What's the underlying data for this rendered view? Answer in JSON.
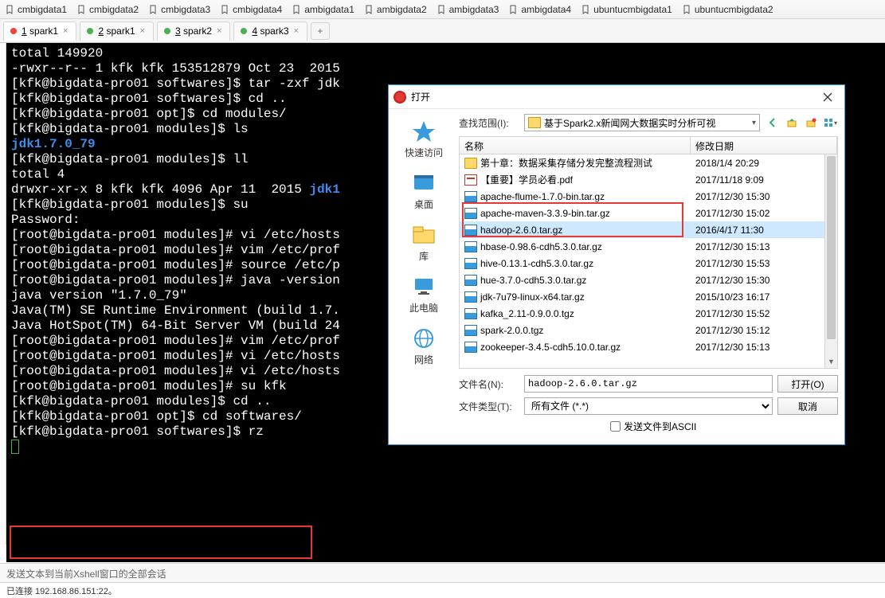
{
  "bookmarks": [
    "cmbigdata1",
    "cmbigdata2",
    "cmbigdata3",
    "cmbigdata4",
    "ambigdata1",
    "ambigdata2",
    "ambigdata3",
    "ambigdata4",
    "ubuntucmbigdata1",
    "ubuntucmbigdata2"
  ],
  "tabs": [
    {
      "num": "1",
      "label": "spark1",
      "active": true,
      "dot": "red"
    },
    {
      "num": "2",
      "label": "spark1",
      "active": false,
      "dot": "green"
    },
    {
      "num": "3",
      "label": "spark2",
      "active": false,
      "dot": "green"
    },
    {
      "num": "4",
      "label": "spark3",
      "active": false,
      "dot": "green"
    }
  ],
  "terminal_lines": [
    {
      "t": "total 149920"
    },
    {
      "t": "-rwxr--r-- 1 kfk kfk 153512879 Oct 23  2015"
    },
    {
      "t": "[kfk@bigdata-pro01 softwares]$ tar -zxf jdk"
    },
    {
      "t": "[kfk@bigdata-pro01 softwares]$ cd .."
    },
    {
      "t": "[kfk@bigdata-pro01 opt]$ cd modules/"
    },
    {
      "t": "[kfk@bigdata-pro01 modules]$ ls"
    },
    {
      "t": "jdk1.7.0_79",
      "cls": "dir"
    },
    {
      "t": "[kfk@bigdata-pro01 modules]$ ll"
    },
    {
      "t": "total 4"
    },
    {
      "t": "drwxr-xr-x 8 kfk kfk 4096 Apr 11  2015 ",
      "tail": "jdk1",
      "tailcls": "dir"
    },
    {
      "t": "[kfk@bigdata-pro01 modules]$ su"
    },
    {
      "t": "Password:"
    },
    {
      "t": "[root@bigdata-pro01 modules]# vi /etc/hosts"
    },
    {
      "t": "[root@bigdata-pro01 modules]# vim /etc/prof"
    },
    {
      "t": "[root@bigdata-pro01 modules]# source /etc/p"
    },
    {
      "t": "[root@bigdata-pro01 modules]# java -version"
    },
    {
      "t": "java version \"1.7.0_79\""
    },
    {
      "t": "Java(TM) SE Runtime Environment (build 1.7."
    },
    {
      "t": "Java HotSpot(TM) 64-Bit Server VM (build 24"
    },
    {
      "t": "[root@bigdata-pro01 modules]# vim /etc/prof"
    },
    {
      "t": "[root@bigdata-pro01 modules]# vi /etc/hosts"
    },
    {
      "t": "[root@bigdata-pro01 modules]# vi /etc/hosts"
    },
    {
      "t": "[root@bigdata-pro01 modules]# su kfk"
    },
    {
      "t": "[kfk@bigdata-pro01 modules]$ cd .."
    },
    {
      "t": "[kfk@bigdata-pro01 opt]$ cd softwares/"
    },
    {
      "t": "[kfk@bigdata-pro01 softwares]$ rz"
    }
  ],
  "status_text": "发送文本到当前Xshell窗口的全部会话",
  "conn_text": "已连接 192.168.86.151:22。",
  "dialog": {
    "title": "打开",
    "look_label": "查找范围(I):",
    "look_value": "基于Spark2.x新闻网大数据实时分析可视",
    "places": [
      "快速访问",
      "桌面",
      "库",
      "此电脑",
      "网络"
    ],
    "col_name": "名称",
    "col_date": "修改日期",
    "files": [
      {
        "ic": "folder",
        "name": "第十章：数据采集存储分发完整流程测试",
        "date": "2018/1/4 20:29"
      },
      {
        "ic": "pdf",
        "name": "【重要】学员必看.pdf",
        "date": "2017/11/18 9:09"
      },
      {
        "ic": "zip",
        "name": "apache-flume-1.7.0-bin.tar.gz",
        "date": "2017/12/30 15:30"
      },
      {
        "ic": "zip",
        "name": "apache-maven-3.3.9-bin.tar.gz",
        "date": "2017/12/30 15:02"
      },
      {
        "ic": "zip",
        "name": "hadoop-2.6.0.tar.gz",
        "date": "2016/4/17 11:30",
        "sel": true
      },
      {
        "ic": "zip",
        "name": "hbase-0.98.6-cdh5.3.0.tar.gz",
        "date": "2017/12/30 15:13"
      },
      {
        "ic": "zip",
        "name": "hive-0.13.1-cdh5.3.0.tar.gz",
        "date": "2017/12/30 15:53"
      },
      {
        "ic": "zip",
        "name": "hue-3.7.0-cdh5.3.0.tar.gz",
        "date": "2017/12/30 15:30"
      },
      {
        "ic": "zip",
        "name": "jdk-7u79-linux-x64.tar.gz",
        "date": "2015/10/23 16:17"
      },
      {
        "ic": "zip",
        "name": "kafka_2.11-0.9.0.0.tgz",
        "date": "2017/12/30 15:52"
      },
      {
        "ic": "zip",
        "name": "spark-2.0.0.tgz",
        "date": "2017/12/30 15:12"
      },
      {
        "ic": "zip",
        "name": "zookeeper-3.4.5-cdh5.10.0.tar.gz",
        "date": "2017/12/30 15:13"
      }
    ],
    "filename_label": "文件名(N):",
    "filename_value": "hadoop-2.6.0.tar.gz",
    "filetype_label": "文件类型(T):",
    "filetype_value": "所有文件 (*.*)",
    "open_btn": "打开(O)",
    "cancel_btn": "取消",
    "ascii_chk": "发送文件到ASCII"
  }
}
